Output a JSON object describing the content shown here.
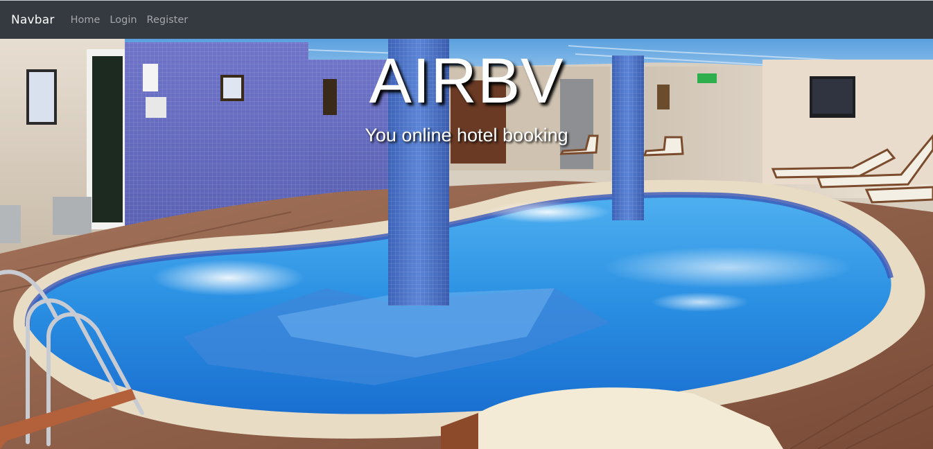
{
  "navbar": {
    "brand": "Navbar",
    "links": [
      {
        "label": "Home"
      },
      {
        "label": "Login"
      },
      {
        "label": "Register"
      }
    ],
    "background_color": "#343a40"
  },
  "hero": {
    "title": "AIRBV",
    "subtitle": "You online hotel booking",
    "background_image": "indoor-swimming-pool-photo"
  }
}
